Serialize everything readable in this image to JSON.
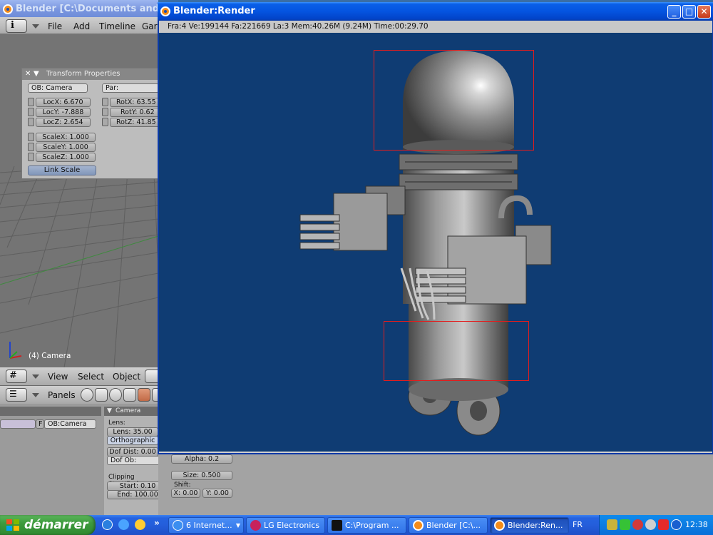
{
  "blender_main": {
    "title": "Blender [C:\\Documents and Setti",
    "menu": [
      "File",
      "Add",
      "Timeline",
      "Gar"
    ],
    "transform_panel": {
      "title": "Transform Properties",
      "ob_field": "OB: Camera",
      "par_field": "Par:",
      "loc": [
        "LocX: 6.670",
        "LocY: -7.888",
        "LocZ: 2.654"
      ],
      "rot": [
        "RotX: 63.55",
        "RotY: 0.62",
        "RotZ: 41.85"
      ],
      "scale": [
        "ScaleX: 1.000",
        "ScaleY: 1.000",
        "ScaleZ: 1.000"
      ],
      "link_scale": "Link Scale"
    },
    "viewport_label": "(4) Camera",
    "view_header": [
      "View",
      "Select",
      "Object"
    ],
    "buttons_header": "Panels",
    "camera_panel": {
      "title": "Camera",
      "ob_name": "OB:Camera",
      "ob_prefix": "F",
      "lens_label": "Lens:",
      "lens_value": "Lens: 35.00",
      "ortho": "Orthographic",
      "dof_dist": "Dof Dist: 0.00",
      "dof_ob": "Dof Ob:",
      "alpha": "Alpha: 0.2",
      "clipping_label": "Clipping Start/End:",
      "clip_start": "Start: 0.10",
      "clip_end": "End: 100.00",
      "size": "Size: 0.500",
      "shift_label": "Shift:",
      "shift_x": "X: 0.00",
      "shift_y": "Y: 0.00"
    }
  },
  "render_window": {
    "title": "Blender:Render",
    "info": "Fra:4  Ve:199144 Fa:221669 La:3 Mem:40.26M (9.24M) Time:00:29.70",
    "background_color": "#0f3c73"
  },
  "taskbar": {
    "start": "démarrer",
    "items": [
      "6 Internet...",
      "LG Electronics",
      "C:\\Program ...",
      "Blender [C:\\...",
      "Blender:Ren..."
    ],
    "lang": "FR",
    "clock": "12:38"
  }
}
